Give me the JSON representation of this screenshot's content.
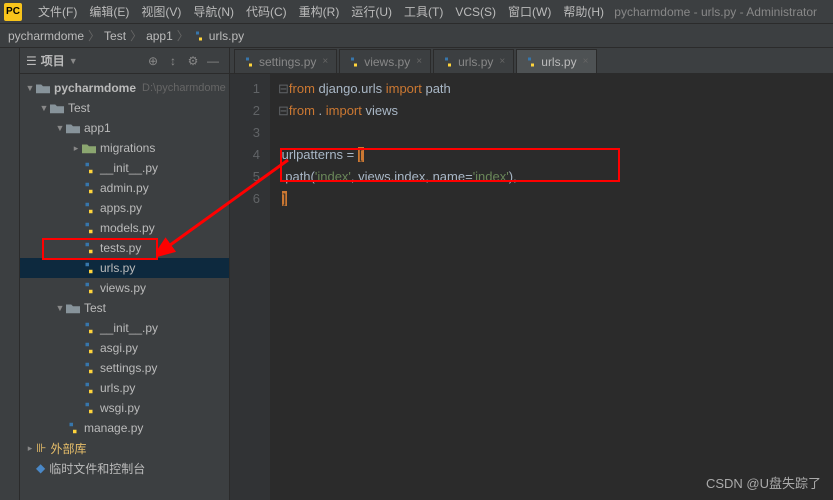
{
  "title": "pycharmdome - urls.py - Administrator",
  "menu": [
    "文件(F)",
    "编辑(E)",
    "视图(V)",
    "导航(N)",
    "代码(C)",
    "重构(R)",
    "运行(U)",
    "工具(T)",
    "VCS(S)",
    "窗口(W)",
    "帮助(H)"
  ],
  "breadcrumb": [
    "pycharmdome",
    "Test",
    "app1",
    "urls.py"
  ],
  "pane": {
    "title": "项目",
    "collapse": "▼"
  },
  "tree": {
    "root": {
      "name": "pycharmdome",
      "path": "D:\\pycharmdome"
    },
    "test": "Test",
    "app1": "app1",
    "migrations": "migrations",
    "files": [
      "__init__.py",
      "admin.py",
      "apps.py",
      "models.py",
      "tests.py",
      "urls.py",
      "views.py"
    ],
    "test2": "Test",
    "files2": [
      "__init__.py",
      "asgi.py",
      "settings.py",
      "urls.py",
      "wsgi.py"
    ],
    "manage": "manage.py",
    "extlib": "外部库",
    "scratch": "临时文件和控制台"
  },
  "tabs": [
    {
      "label": "settings.py",
      "active": false
    },
    {
      "label": "views.py",
      "active": false
    },
    {
      "label": "urls.py",
      "active": false
    },
    {
      "label": "urls.py",
      "active": true
    }
  ],
  "code": {
    "lines": [
      "1",
      "2",
      "3",
      "4",
      "5",
      "6"
    ],
    "l1a": "from",
    "l1b": " django.urls ",
    "l1c": "import",
    "l1d": " path",
    "l2a": "from",
    "l2b": " . ",
    "l2c": "import",
    "l2d": " views",
    "l4a": "urlpatterns = ",
    "l4b": "[",
    "l5a": "    path(",
    "l5b": "'index'",
    "l5c": ", views.index, name=",
    "l5d": "'index'",
    "l5e": "),",
    "l6a": "]"
  },
  "watermark": "CSDN @U盘失踪了"
}
